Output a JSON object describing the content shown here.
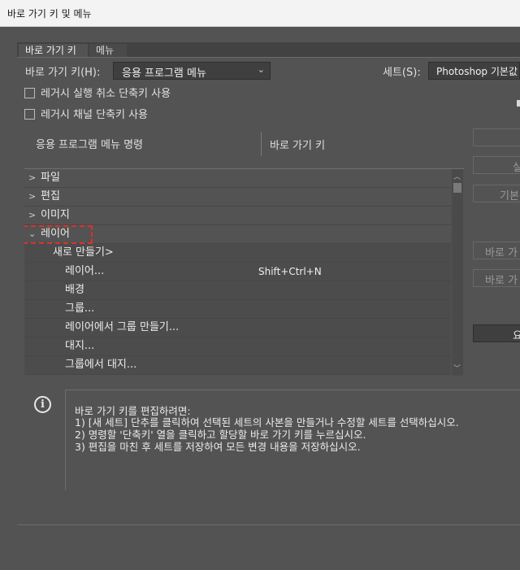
{
  "window": {
    "title": "바로 가기 키 및 메뉴"
  },
  "tabs": [
    {
      "label": "바로 가기 키"
    },
    {
      "label": "메뉴"
    }
  ],
  "shortcuts_for": {
    "label": "바로 가기 키(H):",
    "value": "응용 프로그램 메뉴"
  },
  "set": {
    "label": "세트(S):",
    "value": "Photoshop 기본값"
  },
  "options": [
    {
      "label": "레거시 실행 취소 단축키 사용",
      "checked": false
    },
    {
      "label": "레거시 채널 단축키 사용",
      "checked": false
    }
  ],
  "columns": {
    "command": "응용 프로그램 메뉴 명령",
    "shortcut": "바로 가기 키"
  },
  "tree": [
    {
      "label": "파일",
      "level": 0,
      "expanded": false,
      "shortcut": ""
    },
    {
      "label": "편집",
      "level": 0,
      "expanded": false,
      "shortcut": ""
    },
    {
      "label": "이미지",
      "level": 0,
      "expanded": false,
      "shortcut": ""
    },
    {
      "label": "레이어",
      "level": 0,
      "expanded": true,
      "shortcut": "",
      "highlighted": true
    },
    {
      "label": "새로 만들기>",
      "level": 1,
      "shortcut": ""
    },
    {
      "label": "레이어...",
      "level": 2,
      "shortcut": "Shift+Ctrl+N"
    },
    {
      "label": "배경",
      "level": 2,
      "shortcut": ""
    },
    {
      "label": "그룹...",
      "level": 2,
      "shortcut": ""
    },
    {
      "label": "레이어에서 그룹 만들기...",
      "level": 2,
      "shortcut": ""
    },
    {
      "label": "대지...",
      "level": 2,
      "shortcut": ""
    },
    {
      "label": "그룹에서 대지...",
      "level": 2,
      "shortcut": ""
    }
  ],
  "right_buttons": [
    {
      "label": ""
    },
    {
      "label": "실"
    },
    {
      "label": "기본"
    },
    {
      "label": "바로 가"
    },
    {
      "label": "바로 가"
    },
    {
      "label": "요"
    }
  ],
  "info": {
    "icon": "info-icon",
    "lines": [
      "바로 가기 키를 편집하려면:",
      "1) [새 세트] 단추를 클릭하여 선택된 세트의 사본을 만들거나 수정할 세트를 선택하십시오.",
      "2) 명령할 '단축키' 열을 클릭하고 할당할 바로 가기 키를 누르십시오.",
      "3) 편집을 마친 후 세트를 저장하여 모든 변경 내용을 저장하십시오."
    ]
  },
  "colors": {
    "dialog_bg": "#535353",
    "titlebar_bg": "#f3f3f3",
    "highlight": "#e0302a"
  }
}
